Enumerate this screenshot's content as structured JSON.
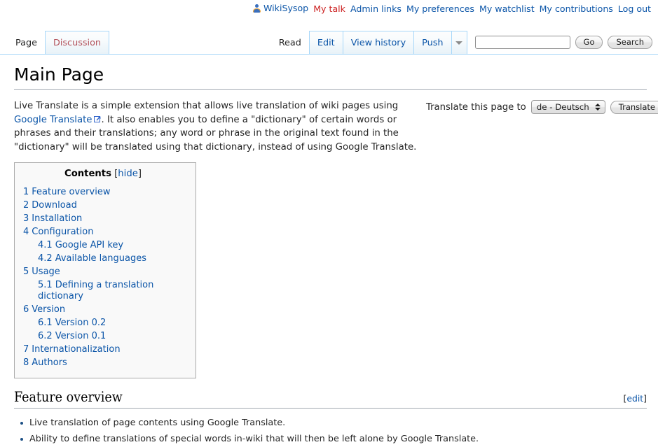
{
  "personal_bar": {
    "user_icon": "user-avatar-icon",
    "items": [
      {
        "label": "WikiSysop",
        "style": "user"
      },
      {
        "label": "My talk",
        "style": "new"
      },
      {
        "label": "Admin links",
        "style": "link"
      },
      {
        "label": "My preferences",
        "style": "link"
      },
      {
        "label": "My watchlist",
        "style": "link"
      },
      {
        "label": "My contributions",
        "style": "link"
      },
      {
        "label": "Log out",
        "style": "plain"
      }
    ]
  },
  "namespace_tabs": [
    {
      "label": "Page",
      "selected": true,
      "new": false
    },
    {
      "label": "Discussion",
      "selected": false,
      "new": true
    }
  ],
  "view_tabs": [
    {
      "label": "Read",
      "selected": true
    },
    {
      "label": "Edit",
      "selected": false
    },
    {
      "label": "View history",
      "selected": false
    },
    {
      "label": "Push",
      "selected": false
    }
  ],
  "tab_more": {
    "icon": "chevron-down-icon"
  },
  "search": {
    "value": "",
    "placeholder": "",
    "go_label": "Go",
    "search_label": "Search"
  },
  "page": {
    "title": "Main Page",
    "intro_part1": "Live Translate is a simple extension that allows live translation of wiki pages using ",
    "intro_link": "Google Translate",
    "intro_part2": ". It also enables you to define a \"dictionary\" of certain words or phrases and their translations; any word or phrase in the original text found in the \"dictionary\" will be translated using that dictionary, instead of using Google Translate."
  },
  "translate_widget": {
    "label": "Translate this page to",
    "selected_language": "de - Deutsch",
    "button_label": "Translate"
  },
  "toc": {
    "title": "Contents",
    "hide_label": "hide",
    "bracket_open": "[",
    "bracket_close": "]",
    "entries": [
      {
        "num": "1",
        "label": "Feature overview",
        "level": 1
      },
      {
        "num": "2",
        "label": "Download",
        "level": 1
      },
      {
        "num": "3",
        "label": "Installation",
        "level": 1
      },
      {
        "num": "4",
        "label": "Configuration",
        "level": 1
      },
      {
        "num": "4.1",
        "label": "Google API key",
        "level": 2
      },
      {
        "num": "4.2",
        "label": "Available languages",
        "level": 2
      },
      {
        "num": "5",
        "label": "Usage",
        "level": 1
      },
      {
        "num": "5.1",
        "label": "Defining a translation dictionary",
        "level": 2
      },
      {
        "num": "6",
        "label": "Version",
        "level": 1
      },
      {
        "num": "6.1",
        "label": "Version 0.2",
        "level": 2
      },
      {
        "num": "6.2",
        "label": "Version 0.1",
        "level": 2
      },
      {
        "num": "7",
        "label": "Internationalization",
        "level": 1
      },
      {
        "num": "8",
        "label": "Authors",
        "level": 1
      }
    ]
  },
  "section": {
    "heading": "Feature overview",
    "edit_open": "[",
    "edit_label": "edit",
    "edit_close": "]",
    "bullets": [
      "Live translation of page contents using Google Translate.",
      "Ability to define translations of special words in-wiki that will then be left alone by Google Translate."
    ]
  },
  "colors": {
    "link": "#0b55a8",
    "new_link": "#cc2222",
    "tab_border": "#a7d7f9",
    "rule": "#a2a9b1",
    "bullet": "#1b4f85"
  }
}
